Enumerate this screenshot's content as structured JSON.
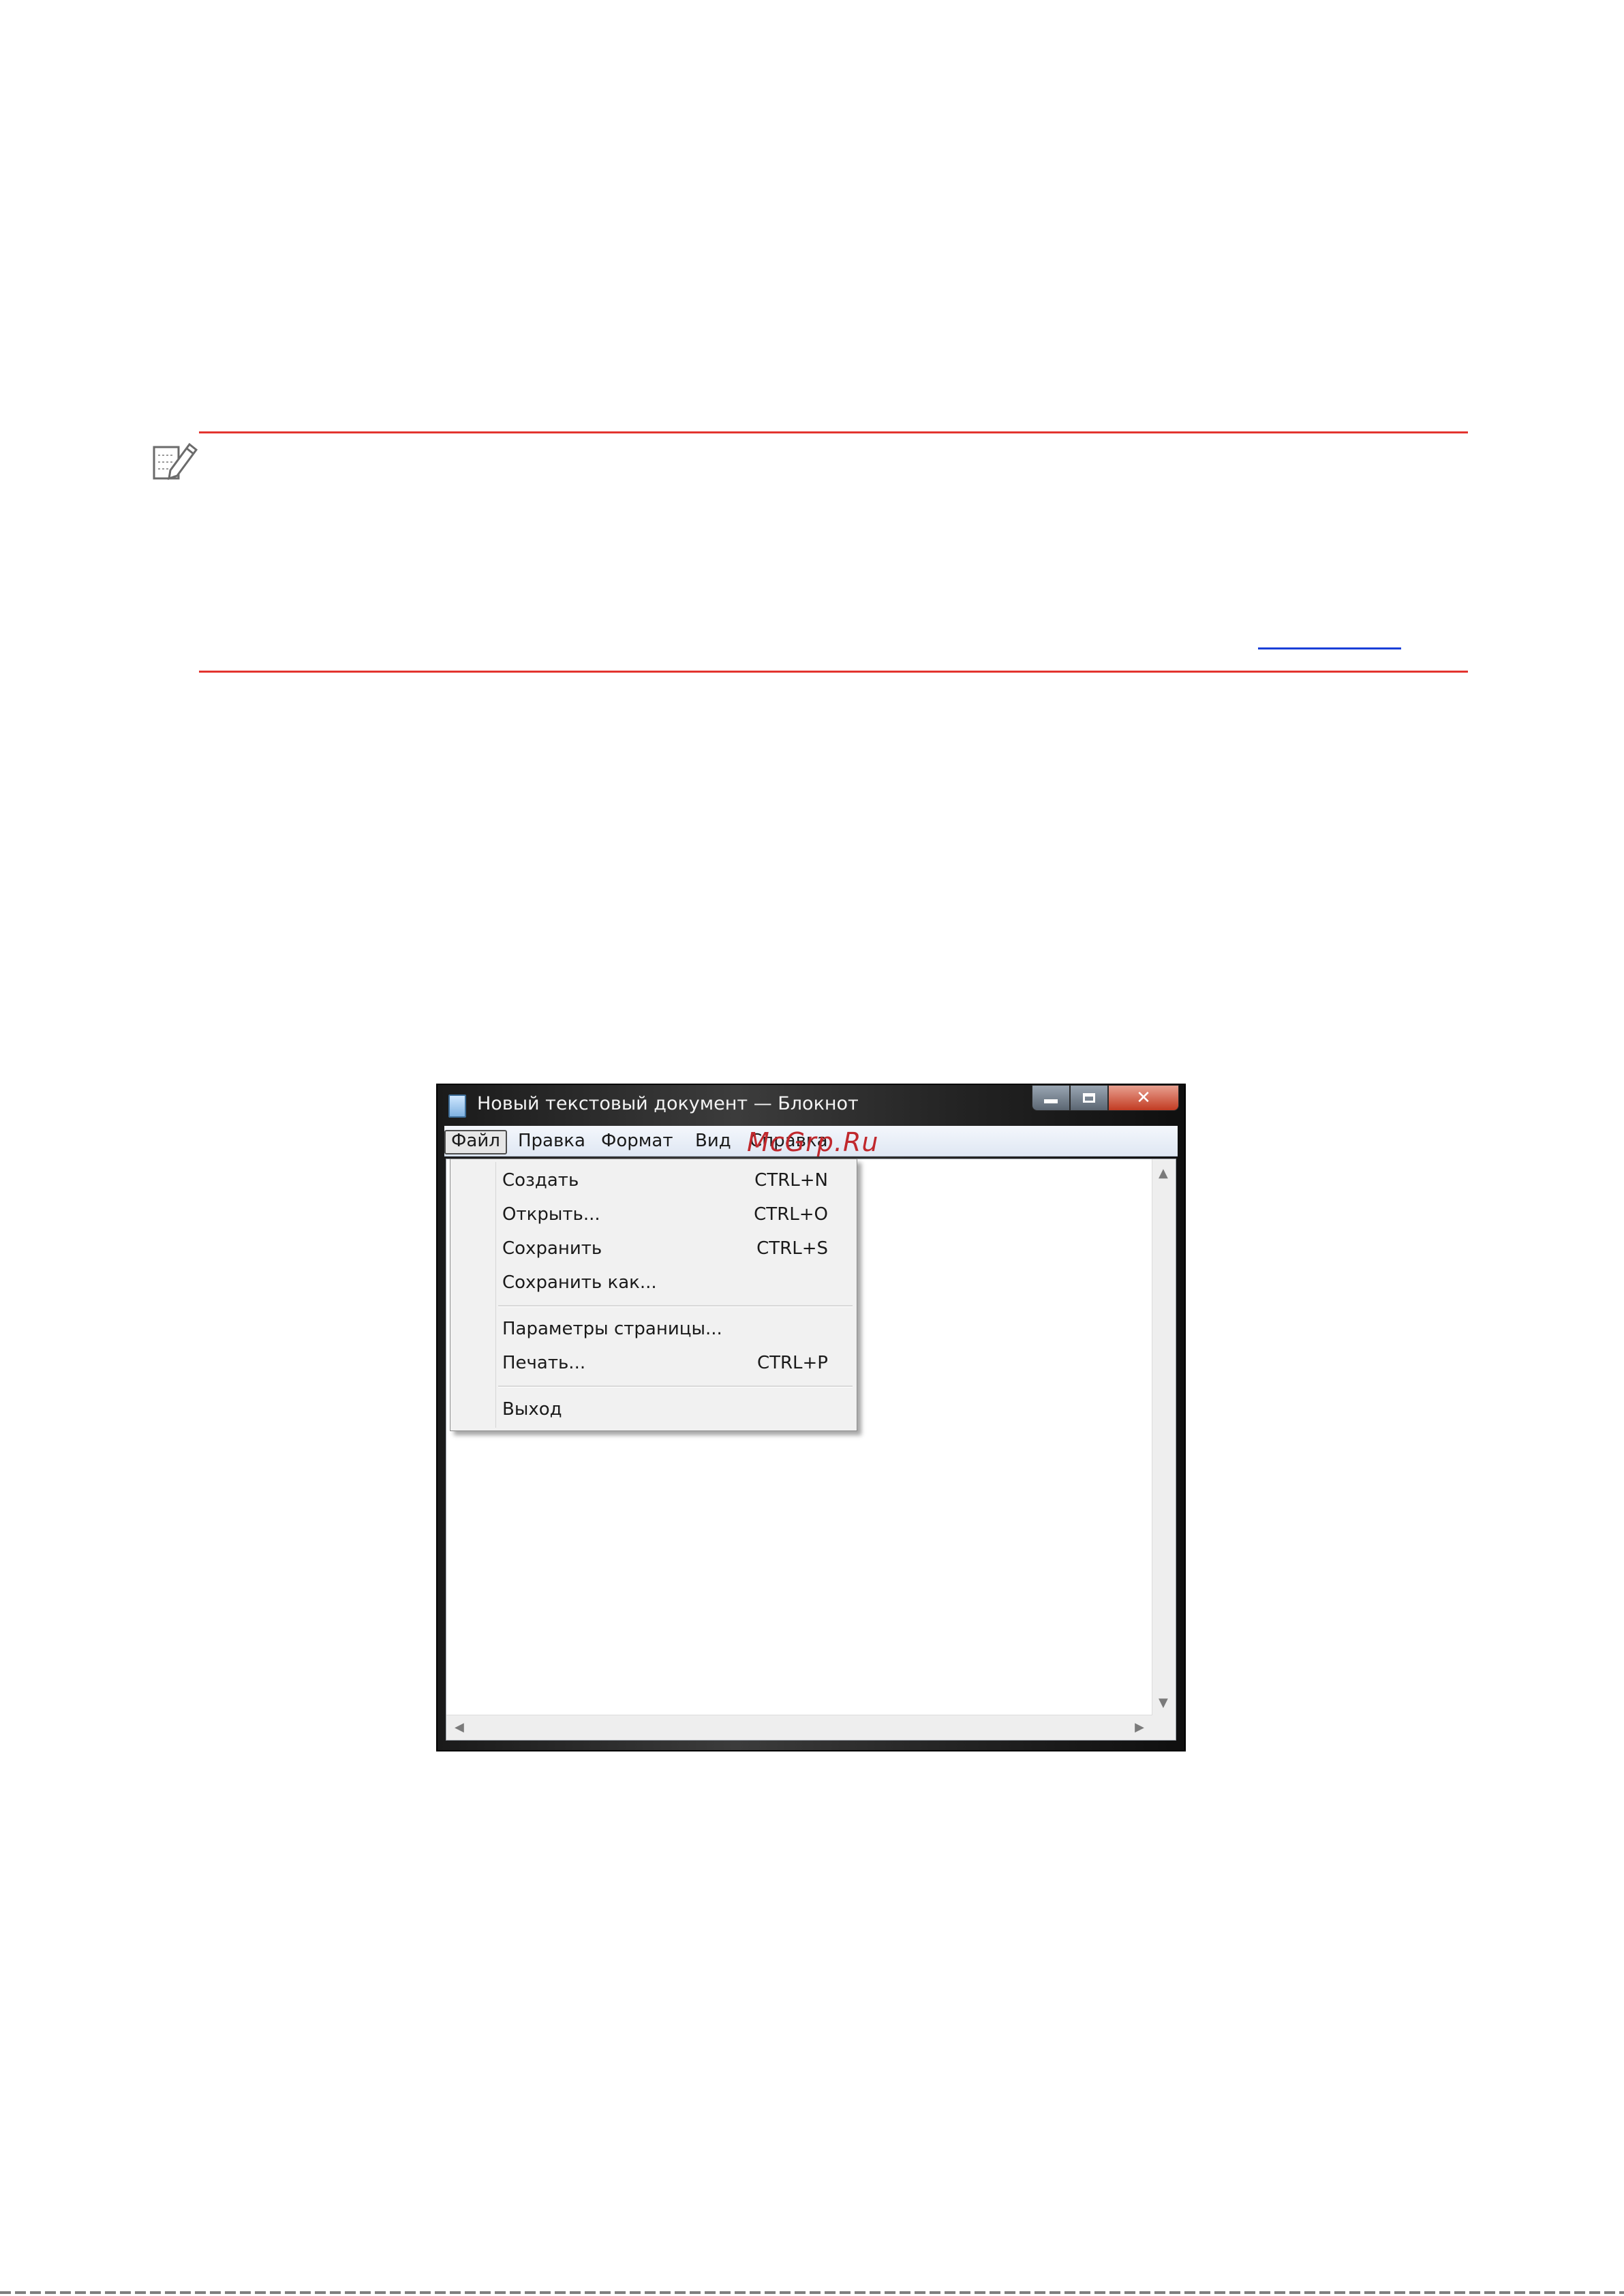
{
  "notepad": {
    "title": "Новый текстовый документ — Блокнот",
    "menu": [
      "Файл",
      "Правка",
      "Формат",
      "Вид",
      "Справка"
    ],
    "file_menu": [
      {
        "label": "Создать",
        "shortcut": "CTRL+N"
      },
      {
        "label": "Открыть...",
        "shortcut": "CTRL+O"
      },
      {
        "label": "Сохранить",
        "shortcut": "CTRL+S"
      },
      {
        "label": "Сохранить как...",
        "shortcut": ""
      },
      {
        "label": "Параметры страницы...",
        "shortcut": ""
      },
      {
        "label": "Печать...",
        "shortcut": "CTRL+P"
      },
      {
        "label": "Выход",
        "shortcut": ""
      }
    ]
  },
  "watermark": "McGrp.Ru",
  "colors": {
    "rule": "#e3342f",
    "link": "#1a3fd8"
  },
  "icons": {
    "note": "note-pencil-icon",
    "notepad": "notepad-icon"
  }
}
